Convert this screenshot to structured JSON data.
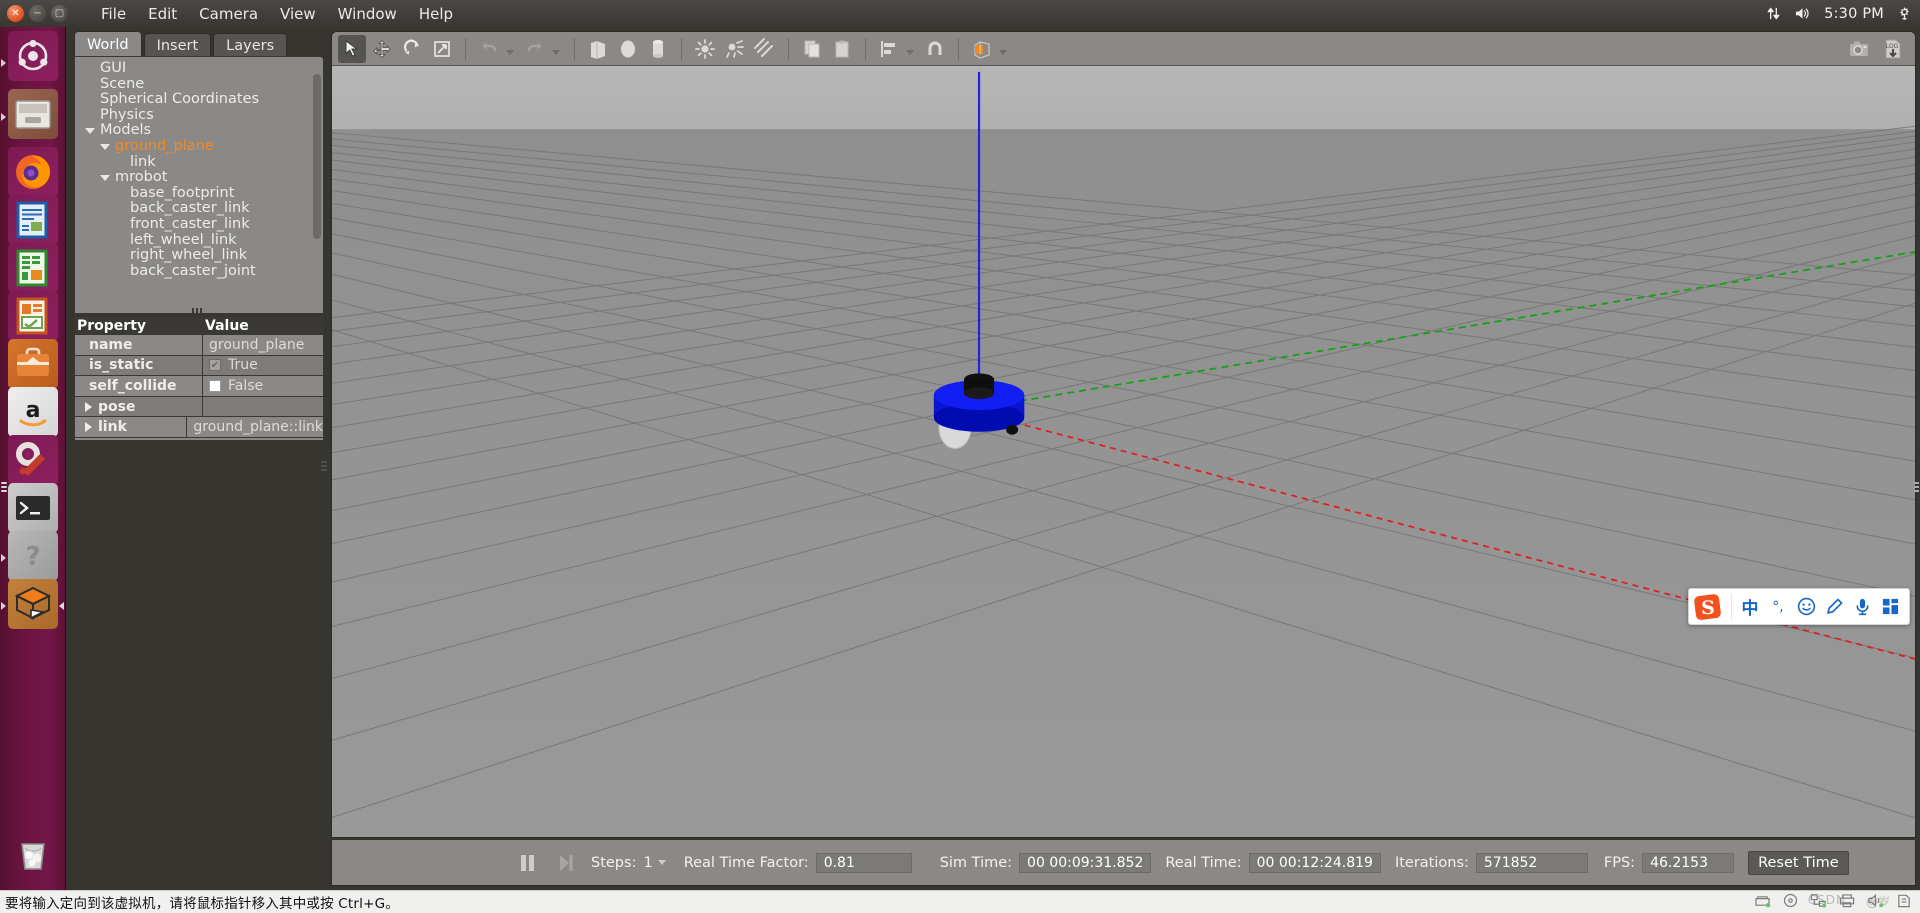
{
  "topbar": {
    "window_controls": [
      "close",
      "minimize",
      "maximize"
    ],
    "menus": [
      "File",
      "Edit",
      "Camera",
      "View",
      "Window",
      "Help"
    ],
    "tray": {
      "network_icon": "network-updown-icon",
      "volume_icon": "volume-icon",
      "clock": "5:30 PM",
      "settings_icon": "gear-icon"
    }
  },
  "launcher": {
    "items": [
      {
        "name": "ubuntu-dash-icon",
        "label": "Ubuntu Dash"
      },
      {
        "name": "files-icon",
        "label": "Files"
      },
      {
        "name": "firefox-icon",
        "label": "Firefox"
      },
      {
        "name": "libreoffice-writer-icon",
        "label": "LibreOffice Writer"
      },
      {
        "name": "libreoffice-calc-icon",
        "label": "LibreOffice Calc"
      },
      {
        "name": "libreoffice-impress-icon",
        "label": "LibreOffice Impress"
      },
      {
        "name": "software-center-icon",
        "label": "Ubuntu Software"
      },
      {
        "name": "amazon-icon",
        "label": "Amazon"
      },
      {
        "name": "system-settings-icon",
        "label": "System Settings"
      },
      {
        "name": "terminal-icon",
        "label": "Terminal"
      },
      {
        "name": "help-icon",
        "label": "Help"
      },
      {
        "name": "gazebo-icon",
        "label": "Gazebo"
      },
      {
        "name": "trash-icon",
        "label": "Trash"
      }
    ]
  },
  "dock": {
    "tabs": [
      {
        "label": "World",
        "active": true
      },
      {
        "label": "Insert",
        "active": false
      },
      {
        "label": "Layers",
        "active": false
      }
    ],
    "tree": [
      {
        "label": "GUI",
        "indent": 1,
        "caret": false,
        "selected": false
      },
      {
        "label": "Scene",
        "indent": 1,
        "caret": false,
        "selected": false
      },
      {
        "label": "Spherical Coordinates",
        "indent": 1,
        "caret": false,
        "selected": false
      },
      {
        "label": "Physics",
        "indent": 1,
        "caret": false,
        "selected": false
      },
      {
        "label": "Models",
        "indent": 0,
        "caret": true,
        "selected": false
      },
      {
        "label": "ground_plane",
        "indent": 1,
        "caret": true,
        "selected": true
      },
      {
        "label": "link",
        "indent": 3,
        "caret": false,
        "selected": false
      },
      {
        "label": "mrobot",
        "indent": 1,
        "caret": true,
        "selected": false
      },
      {
        "label": "base_footprint",
        "indent": 3,
        "caret": false,
        "selected": false
      },
      {
        "label": "back_caster_link",
        "indent": 3,
        "caret": false,
        "selected": false
      },
      {
        "label": "front_caster_link",
        "indent": 3,
        "caret": false,
        "selected": false
      },
      {
        "label": "left_wheel_link",
        "indent": 3,
        "caret": false,
        "selected": false
      },
      {
        "label": "right_wheel_link",
        "indent": 3,
        "caret": false,
        "selected": false
      },
      {
        "label": "back_caster_joint",
        "indent": 3,
        "caret": false,
        "selected": false
      }
    ],
    "properties": {
      "headers": [
        "Property",
        "Value"
      ],
      "rows": [
        {
          "property": "name",
          "value": "ground_plane",
          "kind": "text"
        },
        {
          "property": "is_static",
          "value": "True",
          "kind": "checkbox",
          "checked": true
        },
        {
          "property": "self_collide",
          "value": "False",
          "kind": "checkbox",
          "checked": false
        },
        {
          "property": "pose",
          "value": "",
          "kind": "expander"
        },
        {
          "property": "link",
          "value": "ground_plane::link",
          "kind": "expander"
        }
      ]
    }
  },
  "toolbar": {
    "items": [
      {
        "name": "select-mode-button",
        "glyph": "cursor-arrow-icon",
        "active": true
      },
      {
        "name": "translate-mode-button",
        "glyph": "move-arrows-icon",
        "active": false
      },
      {
        "name": "rotate-mode-button",
        "glyph": "rotate-icon",
        "active": false
      },
      {
        "name": "scale-mode-button",
        "glyph": "scale-icon",
        "active": false
      },
      {
        "name": "undo-button",
        "glyph": "undo-arrow-icon",
        "active": false
      },
      {
        "name": "undo-history-button",
        "glyph": "chevron-down-icon",
        "active": false
      },
      {
        "name": "redo-button",
        "glyph": "redo-arrow-icon",
        "active": false
      },
      {
        "name": "redo-history-button",
        "glyph": "chevron-down-icon",
        "active": false
      },
      {
        "name": "insert-box-button",
        "glyph": "box-icon",
        "active": false
      },
      {
        "name": "insert-sphere-button",
        "glyph": "sphere-icon",
        "active": false
      },
      {
        "name": "insert-cylinder-button",
        "glyph": "cylinder-icon",
        "active": false
      },
      {
        "name": "insert-point-light-button",
        "glyph": "point-light-icon",
        "active": false
      },
      {
        "name": "insert-spot-light-button",
        "glyph": "spot-light-icon",
        "active": false
      },
      {
        "name": "insert-directional-light-button",
        "glyph": "directional-light-icon",
        "active": false
      },
      {
        "name": "copy-button",
        "glyph": "copy-icon",
        "active": false
      },
      {
        "name": "paste-button",
        "glyph": "paste-icon",
        "active": false
      },
      {
        "name": "align-button",
        "glyph": "align-icon",
        "active": false
      },
      {
        "name": "snap-button",
        "glyph": "magnet-icon",
        "active": false
      },
      {
        "name": "view-mode-button",
        "glyph": "wireframe-cube-icon",
        "active": false
      }
    ],
    "right_items": [
      {
        "name": "screenshot-button",
        "glyph": "camera-icon"
      },
      {
        "name": "log-button",
        "glyph": "log-download-icon",
        "label": "LOG"
      }
    ]
  },
  "scene": {
    "sky_color": "#b4b4b4",
    "ground_color": "#949494",
    "grid_color": "#6f6f6f",
    "axes": {
      "x_axis_color": "#e02020",
      "y_axis_color": "#17a017",
      "z_axis_color": "#2222e0"
    },
    "model": {
      "name": "mrobot",
      "body_color": "#0b16e8",
      "top_color": "#141414",
      "caster_color": "#d8d8d8"
    }
  },
  "timepanel": {
    "pause_icon": "pause-icon",
    "step_icon": "step-forward-icon",
    "steps_label": "Steps:",
    "steps_value": "1",
    "real_time_factor_label": "Real Time Factor:",
    "real_time_factor_value": "0.81",
    "sim_time_label": "Sim Time:",
    "sim_time_value": "00 00:09:31.852",
    "real_time_label": "Real Time:",
    "real_time_value": "00 00:12:24.819",
    "iterations_label": "Iterations:",
    "iterations_value": "571852",
    "fps_label": "FPS:",
    "fps_value": "46.2153",
    "reset_button_label": "Reset Time"
  },
  "sogou": {
    "logo": "sogou-s-icon",
    "buttons": [
      {
        "name": "input-mode-chinese-button",
        "glyph": "中"
      },
      {
        "name": "punctuation-mode-button",
        "glyph": "°,"
      },
      {
        "name": "emoji-button",
        "glyph": "☺"
      },
      {
        "name": "handwriting-button",
        "glyph": "pencil-icon"
      },
      {
        "name": "voice-input-button",
        "glyph": "microphone-icon"
      },
      {
        "name": "toolbox-button",
        "glyph": "grid-squares-icon"
      }
    ]
  },
  "vmbar": {
    "message": "要将输入定向到该虚拟机，请将鼠标指针移入其中或按 Ctrl+G。",
    "watermark": "CSDN",
    "watermark_suffix": "@岁",
    "icons": [
      {
        "name": "hard-disk-icon"
      },
      {
        "name": "cd-drive-icon"
      },
      {
        "name": "network-adapter-icon"
      },
      {
        "name": "printer-icon"
      },
      {
        "name": "sound-icon"
      },
      {
        "name": "usb-icon"
      }
    ]
  }
}
